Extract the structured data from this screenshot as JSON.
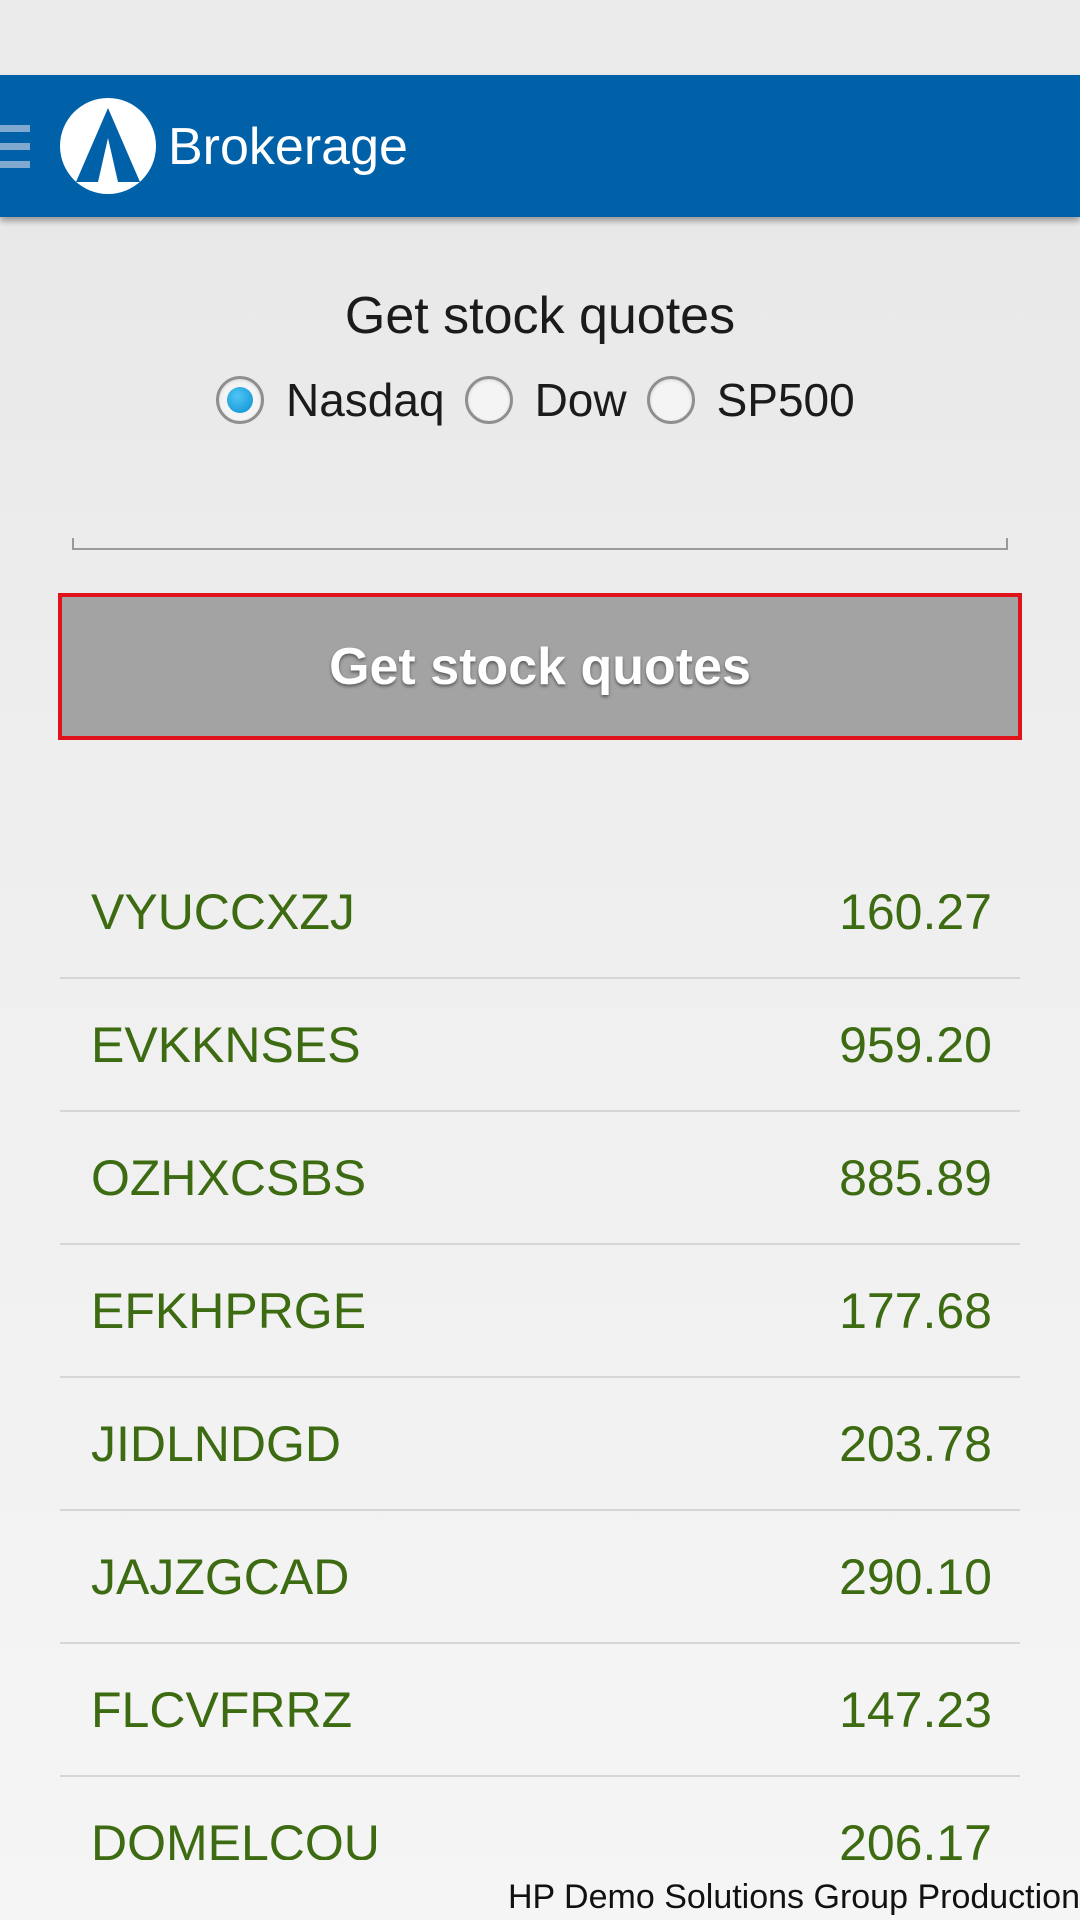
{
  "app_bar": {
    "title": "Brokerage",
    "background": "#0060a8"
  },
  "form": {
    "heading": "Get stock quotes",
    "market_options": [
      {
        "label": "Nasdaq",
        "checked": true
      },
      {
        "label": "Dow",
        "checked": false
      },
      {
        "label": "SP500",
        "checked": false
      }
    ],
    "input_value": "",
    "button_label": "Get stock quotes"
  },
  "quotes": [
    {
      "symbol": "VYUCCXZJ",
      "price": "160.27"
    },
    {
      "symbol": "EVKKNSES",
      "price": "959.20"
    },
    {
      "symbol": "OZHXCSBS",
      "price": "885.89"
    },
    {
      "symbol": "EFKHPRGE",
      "price": "177.68"
    },
    {
      "symbol": "JIDLNDGD",
      "price": "203.78"
    },
    {
      "symbol": "JAJZGCAD",
      "price": "290.10"
    },
    {
      "symbol": "FLCVFRRZ",
      "price": "147.23"
    },
    {
      "symbol": "DOMELCOU",
      "price": "206.17"
    }
  ],
  "footer": "HP Demo Solutions Group Production",
  "colors": {
    "accent": "#0060a8",
    "quote_text": "#3d6b12",
    "button_border": "#e0121b",
    "button_bg": "#a3a3a3",
    "radio_checked": "#0a8fd0"
  },
  "icons": {
    "menu": "hamburger-menu-icon",
    "logo": "app-logo-icon"
  }
}
